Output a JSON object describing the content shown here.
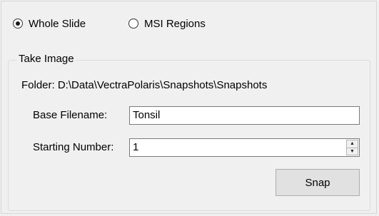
{
  "mode": {
    "options": [
      {
        "label": "Whole Slide",
        "checked": true
      },
      {
        "label": "MSI Regions",
        "checked": false
      }
    ]
  },
  "take_image": {
    "title": "Take Image",
    "folder_text": "Folder: D:\\Data\\VectraPolaris\\Snapshots\\Snapshots",
    "base_filename_label": "Base Filename:",
    "base_filename_value": "Tonsil",
    "starting_number_label": "Starting Number:",
    "starting_number_value": "1",
    "snap_label": "Snap"
  },
  "icons": {
    "spin_up": "spin-up-icon",
    "spin_down": "spin-down-icon"
  }
}
